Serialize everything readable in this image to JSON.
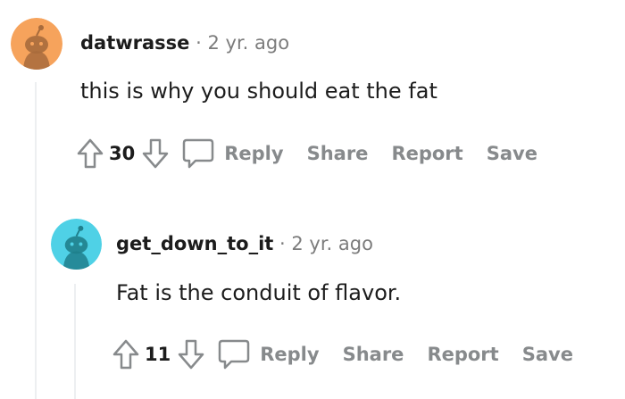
{
  "comments": [
    {
      "username": "datwrasse",
      "separator": "·",
      "age": "2 yr. ago",
      "body": "this is why you should eat the fat",
      "score": "30",
      "actions": {
        "reply": "Reply",
        "share": "Share",
        "report": "Report",
        "save": "Save"
      },
      "avatar_color": "#f6a35c"
    },
    {
      "username": "get_down_to_it",
      "separator": "·",
      "age": "2 yr. ago",
      "body": "Fat is the conduit of flavor.",
      "score": "11",
      "actions": {
        "reply": "Reply",
        "share": "Share",
        "report": "Report",
        "save": "Save"
      },
      "avatar_color": "#4fd1e6"
    }
  ],
  "icons": {
    "upvote": "upvote-icon",
    "downvote": "downvote-icon",
    "reply": "comment-bubble-icon",
    "avatar": "snoo-avatar-icon"
  },
  "colors": {
    "text": "#1c1c1c",
    "muted": "#7c7c7c",
    "action": "#878a8c",
    "thread_line": "#edeff1"
  }
}
